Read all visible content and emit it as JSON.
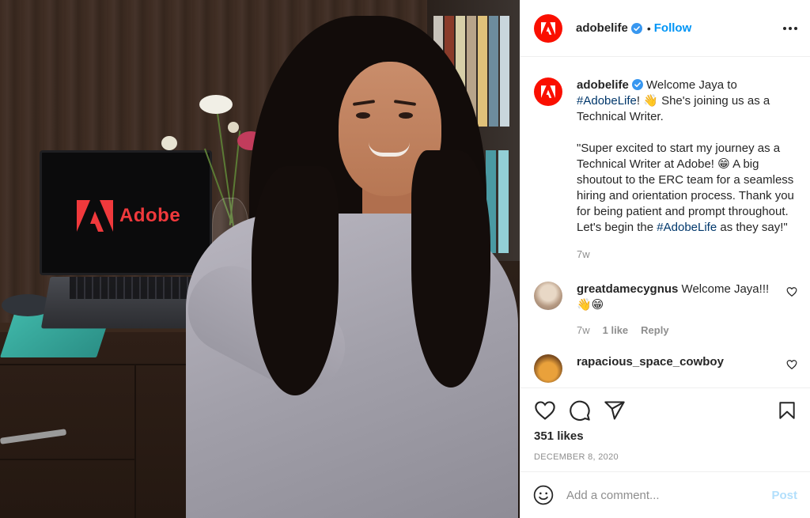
{
  "photo": {
    "laptop_brand_text": "Adobe"
  },
  "header": {
    "username": "adobelife",
    "separator": "•",
    "follow_label": "Follow"
  },
  "caption": {
    "username": "adobelife",
    "text_1": " Welcome Jaya to ",
    "hashtag_1": "#AdobeLife",
    "text_2": "! 👋 She's joining us as a Technical Writer.",
    "quote_1": "\"Super excited to start my journey as a Technical Writer at Adobe! 😁 A big shoutout to the ERC team for a seamless hiring and orientation process. Thank you for being patient and prompt throughout. Let's begin the ",
    "hashtag_2": "#AdobeLife",
    "quote_2": " as they say!\"",
    "time": "7w"
  },
  "comments": [
    {
      "username": "greatdamecygnus",
      "text": " Welcome Jaya!!! 👋😁",
      "time": "7w",
      "likes": "1 like",
      "reply": "Reply"
    },
    {
      "username": "rapacious_space_cowboy"
    }
  ],
  "actions": {
    "likes": "351 likes",
    "date": "DECEMBER 8, 2020"
  },
  "composer": {
    "placeholder": "Add a comment...",
    "post_label": "Post"
  },
  "colors": {
    "brand": "#fa0f00",
    "link": "#0095f6",
    "hashtag": "#00376b",
    "muted": "#8e8e8e"
  },
  "icons": [
    "adobe-logo-icon",
    "verified-badge-icon",
    "more-options-icon",
    "heart-icon",
    "comment-icon",
    "share-icon",
    "bookmark-icon",
    "emoji-icon"
  ]
}
